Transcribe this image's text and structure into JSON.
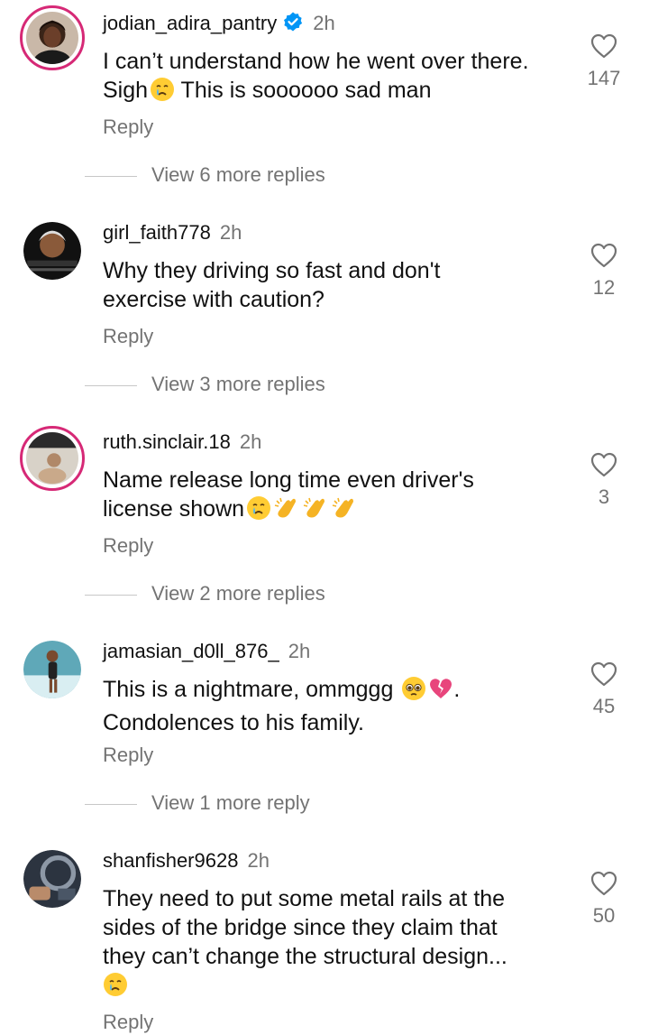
{
  "comments": [
    {
      "username": "jodian_adira_pantry",
      "verified": true,
      "time": "2h",
      "text_lines": [
        "I can’t understand how he went over there.",
        "Sigh",
        "This is soooooo sad man"
      ],
      "reply_label": "Reply",
      "view_replies": "View 6 more replies",
      "likes": "147"
    },
    {
      "username": "girl_faith778",
      "verified": false,
      "time": "2h",
      "text_lines": [
        "Why they driving so fast and don't",
        "exercise with caution?"
      ],
      "reply_label": "Reply",
      "view_replies": "View 3 more replies",
      "likes": "12"
    },
    {
      "username": "ruth.sinclair.18",
      "verified": false,
      "time": "2h",
      "text_lines": [
        "Name release long time even driver's",
        "license shown"
      ],
      "reply_label": "Reply",
      "view_replies": "View 2 more replies",
      "likes": "3"
    },
    {
      "username": "jamasian_d0ll_876_",
      "verified": false,
      "time": "2h",
      "text_lines": [
        "This is a nightmare, ommggg",
        ".",
        "Condolences to his family."
      ],
      "reply_label": "Reply",
      "view_replies": "View 1 more reply",
      "likes": "45"
    },
    {
      "username": "shanfisher9628",
      "verified": false,
      "time": "2h",
      "text_lines": [
        "They need to put some metal rails at the",
        "sides of the bridge since they claim that",
        "they can’t change the structural design..."
      ],
      "reply_label": "Reply",
      "likes": "50"
    }
  ],
  "icons": {
    "like": "heart-outline-icon",
    "verified": "verified-badge-icon"
  },
  "colors": {
    "ring": "#d62976",
    "muted": "#737373",
    "verified": "#0095f6"
  }
}
